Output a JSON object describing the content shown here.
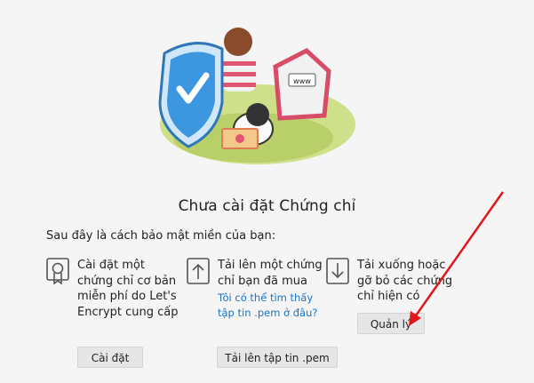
{
  "main": {
    "title": "Chưa cài đặt Chứng chỉ",
    "intro": "Sau đây là cách bảo mật miền của bạn:",
    "illustration_sign": "www"
  },
  "options": [
    {
      "icon": "certificate-icon",
      "text": "Cài đặt một chứng chỉ cơ bản miễn phí do Let's Encrypt cung cấp",
      "button": "Cài đặt"
    },
    {
      "icon": "upload-icon",
      "text": "Tải lên một chứng chỉ bạn đã mua",
      "link": "Tôi có thể tìm thấy tập tin .pem ở đâu?",
      "button": "Tải lên tập tin .pem"
    },
    {
      "icon": "download-icon",
      "text": "Tải xuống hoặc gỡ bỏ các chứng chỉ hiện có",
      "button": "Quản lý"
    }
  ],
  "colors": {
    "annotation_arrow": "#e0161b",
    "link": "#1a73c4",
    "shield": "#3d97e0"
  }
}
